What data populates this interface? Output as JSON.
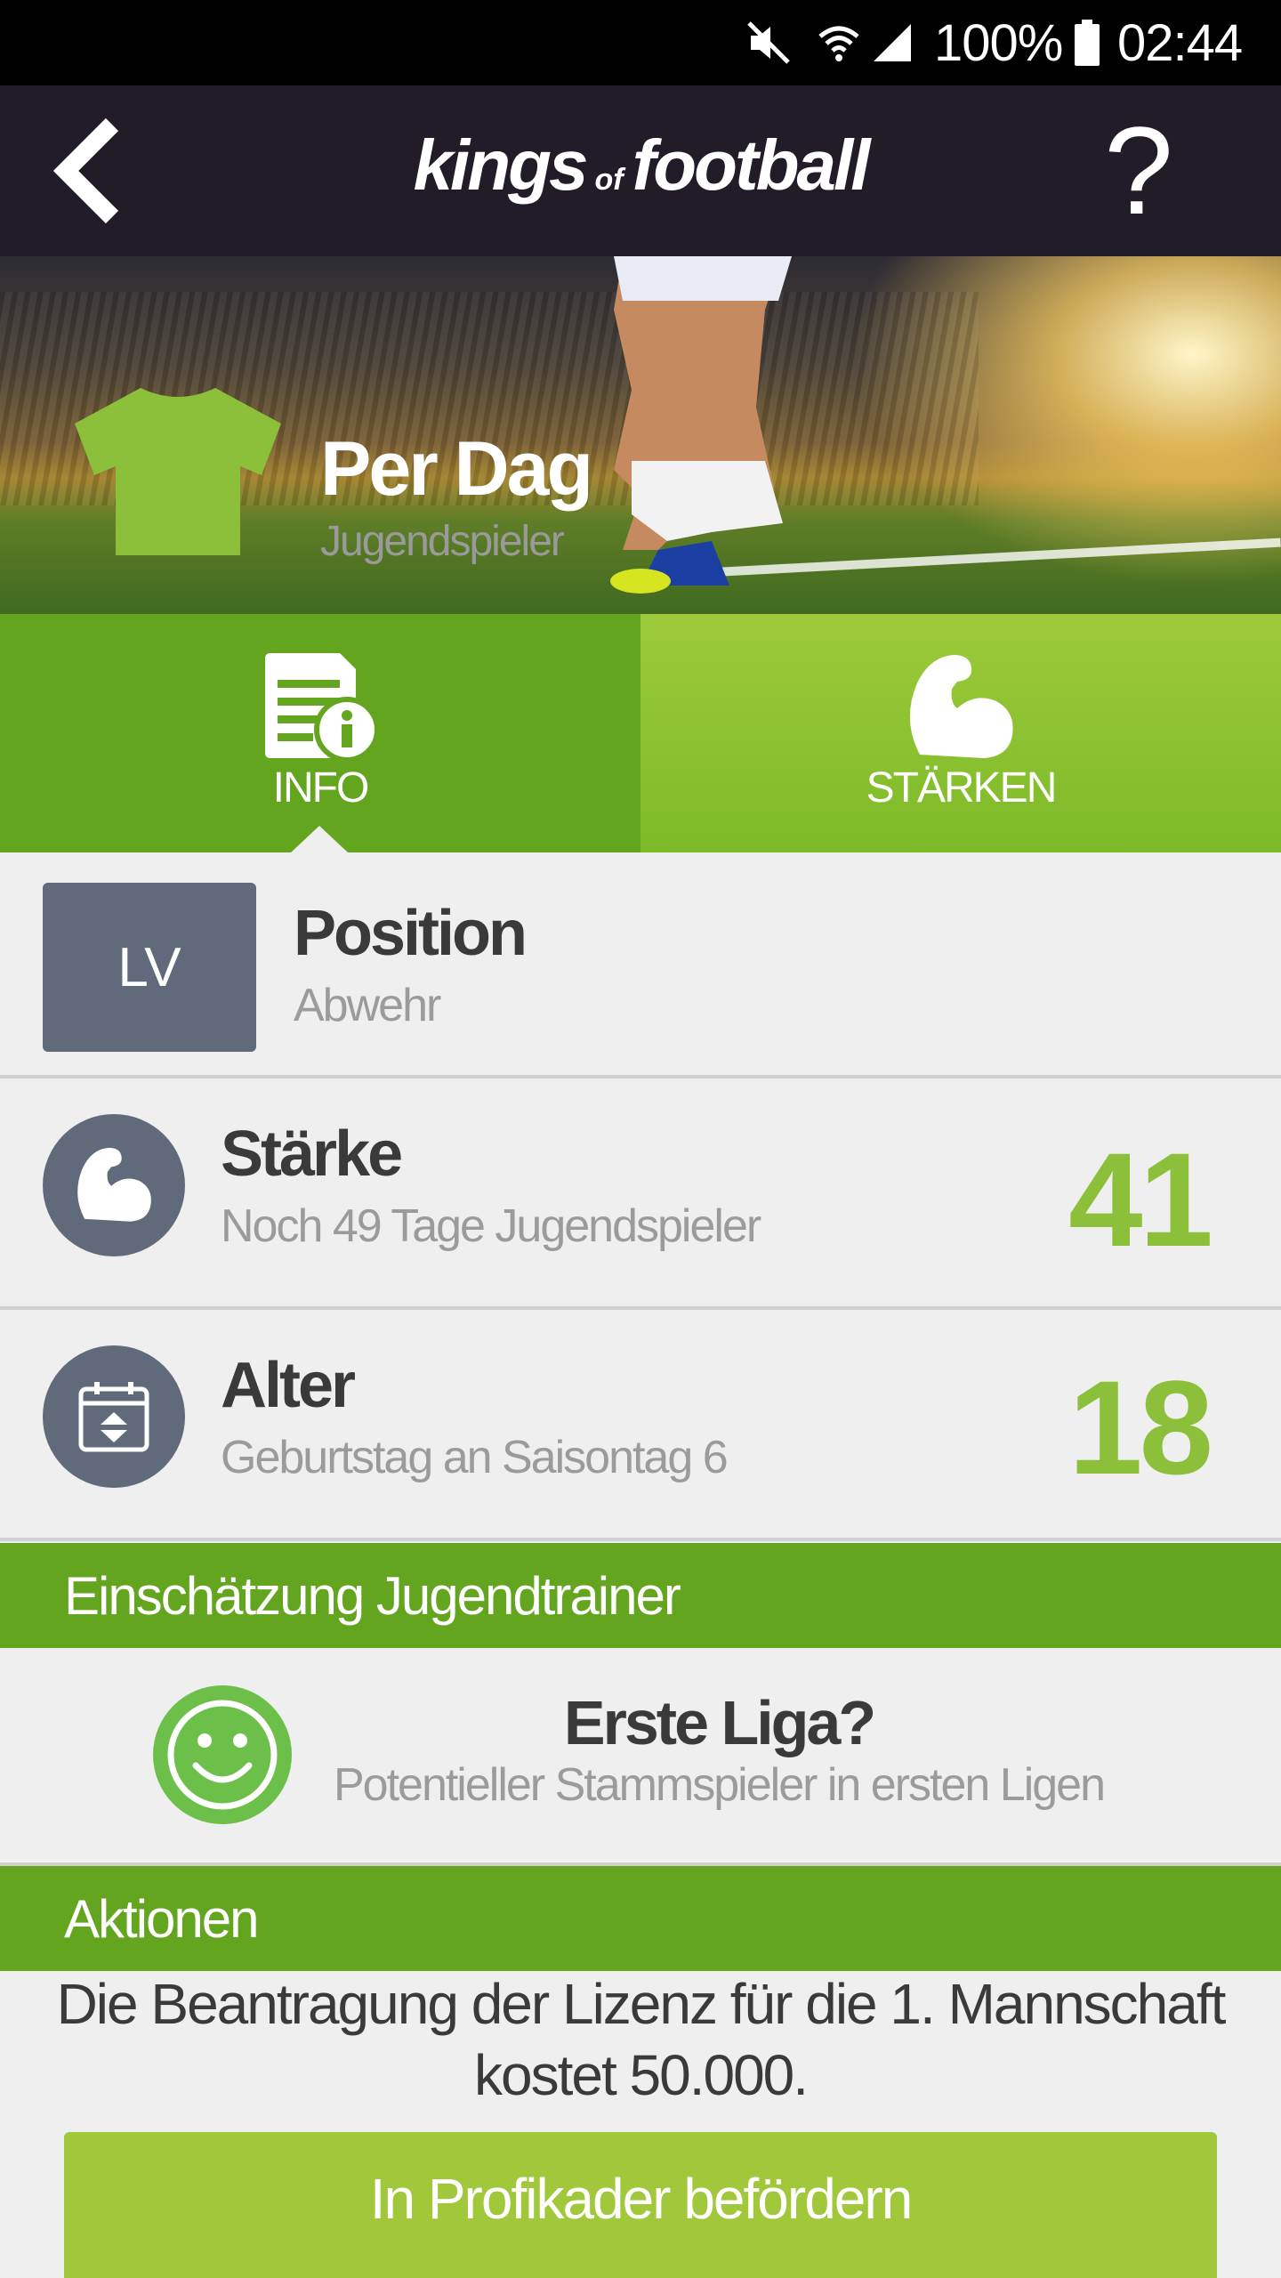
{
  "status_bar": {
    "battery_percent": "100%",
    "time": "02:44",
    "icons": [
      "mute-icon",
      "wifi-icon",
      "signal-icon",
      "battery-icon"
    ]
  },
  "app_bar": {
    "logo": {
      "part1": "kings",
      "part2": "of",
      "part3": "football"
    },
    "help_label": "?",
    "back_icon": "chevron-left-icon"
  },
  "hero": {
    "player_name": "Per Dag",
    "player_type": "Jugendspieler",
    "shirt_color": "#8cc03a"
  },
  "tabs": [
    {
      "label": "INFO",
      "icon": "document-info-icon",
      "active": true
    },
    {
      "label": "STÄRKEN",
      "icon": "flexed-arm-icon",
      "active": false
    }
  ],
  "info": {
    "position": {
      "badge": "LV",
      "title": "Position",
      "subtitle": "Abwehr"
    },
    "strength": {
      "title": "Stärke",
      "subtitle": "Noch 49 Tage Jugendspieler",
      "value": "41"
    },
    "age": {
      "title": "Alter",
      "subtitle": "Geburtstag an Saisontag 6",
      "value": "18"
    }
  },
  "trainer": {
    "header": "Einschätzung Jugendtrainer",
    "title": "Erste Liga?",
    "subtitle": "Potentieller Stammspieler in ersten Ligen",
    "icon": "smiley-icon"
  },
  "actions": {
    "header": "Aktionen",
    "text_line1": "Die Beantragung der Lizenz für die 1. Mannschaft",
    "text_line2": "kostet 50.000.",
    "button_label": "In Profikader befördern"
  },
  "colors": {
    "accent_green": "#63a51f",
    "light_green": "#8cc03a",
    "app_bar": "#221c28",
    "badge_gray": "#616a7a"
  }
}
